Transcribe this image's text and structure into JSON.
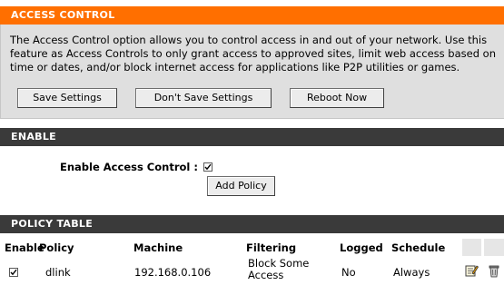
{
  "access_control": {
    "title": "ACCESS CONTROL",
    "description": "The Access Control option allows you to control access in and out of your network. Use this feature as Access Controls to only grant access to approved sites, limit web access based on time or dates, and/or block internet access for applications like P2P utilities or games.",
    "buttons": {
      "save": "Save Settings",
      "dont_save": "Don't Save Settings",
      "reboot": "Reboot Now"
    }
  },
  "enable": {
    "title": "ENABLE",
    "label": "Enable Access Control :",
    "checked": true,
    "add_policy": "Add Policy"
  },
  "policy_table": {
    "title": "POLICY TABLE",
    "headers": {
      "enable": "Enable",
      "policy": "Policy",
      "machine": "Machine",
      "filtering": "Filtering",
      "logged": "Logged",
      "schedule": "Schedule"
    },
    "rows": [
      {
        "enabled": true,
        "policy": "dlink",
        "machine": "192.168.0.106",
        "filtering_line1": "Block Some",
        "filtering_line2": "Access",
        "logged": "No",
        "schedule": "Always",
        "edit_icon": "edit-icon",
        "delete_icon": "trash-icon"
      }
    ]
  },
  "colors": {
    "accent": "#ff6f00",
    "section_dark": "#3a3a3a",
    "panel": "#dfdfdf"
  }
}
